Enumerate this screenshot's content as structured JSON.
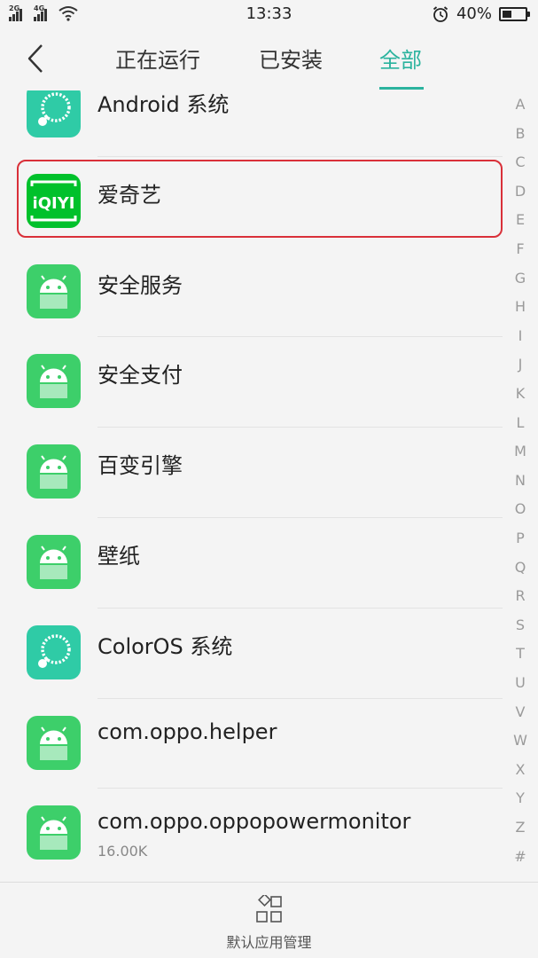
{
  "status_bar": {
    "sim1_label": "2G",
    "sim2_label": "4G",
    "time": "13:33",
    "battery_text": "40%",
    "battery_level_percent": 40,
    "icons": [
      "signal-icon",
      "signal-icon",
      "wifi-icon",
      "alarm-icon",
      "battery-icon"
    ]
  },
  "nav": {
    "back_icon": "chevron-left-icon",
    "tabs": [
      {
        "label": "正在运行",
        "active": false
      },
      {
        "label": "已安装",
        "active": false
      },
      {
        "label": "全部",
        "active": true
      }
    ]
  },
  "apps": [
    {
      "name": "Android 系统",
      "size": "",
      "icon": "coloros-icon"
    },
    {
      "name": "爱奇艺",
      "size": "",
      "icon": "iqiyi-icon",
      "icon_text": "iQIYI",
      "highlighted": true
    },
    {
      "name": "安全服务",
      "size": "",
      "icon": "android-icon"
    },
    {
      "name": "安全支付",
      "size": "",
      "icon": "android-icon"
    },
    {
      "name": "百变引擎",
      "size": "",
      "icon": "android-icon"
    },
    {
      "name": "壁纸",
      "size": "",
      "icon": "android-icon"
    },
    {
      "name": "ColorOS 系统",
      "size": "",
      "icon": "coloros-icon"
    },
    {
      "name": "com.oppo.helper",
      "size": "",
      "icon": "android-icon"
    },
    {
      "name": "com.oppo.oppopowermonitor",
      "size": "16.00K",
      "icon": "android-icon"
    }
  ],
  "alphabet_index": [
    "A",
    "B",
    "C",
    "D",
    "E",
    "F",
    "G",
    "H",
    "I",
    "J",
    "K",
    "L",
    "M",
    "N",
    "O",
    "P",
    "Q",
    "R",
    "S",
    "T",
    "U",
    "V",
    "W",
    "X",
    "Y",
    "Z",
    "#"
  ],
  "bottom_bar": {
    "label": "默认应用管理",
    "icon": "grid-icon"
  },
  "colors": {
    "accent": "#2bb39e",
    "android_green": "#3dcf6a",
    "iqiyi_green": "#00c12b",
    "coloros_teal": "#2fcba6",
    "highlight_red": "#d93039"
  }
}
